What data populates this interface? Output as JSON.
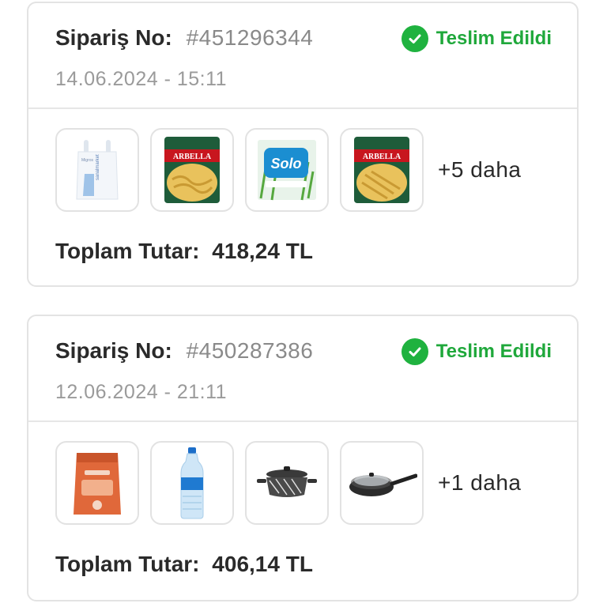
{
  "orders": [
    {
      "order_label": "Sipariş No:",
      "order_number": "#451296344",
      "date": "14.06.2024 - 15:11",
      "status": "Teslim Edildi",
      "items": [
        {
          "name": "migros-bag-icon",
          "text": "sanalmarket"
        },
        {
          "name": "arbella-pasta-icon",
          "text": "ARBELLA"
        },
        {
          "name": "solo-napkin-icon",
          "text": "Solo"
        },
        {
          "name": "arbella-pasta-icon",
          "text": "ARBELLA"
        }
      ],
      "more": "+5 daha",
      "total_label": "Toplam Tutar:",
      "total_amount": "418,24 TL"
    },
    {
      "order_label": "Sipariş No:",
      "order_number": "#450287386",
      "date": "12.06.2024 - 21:11",
      "status": "Teslim Edildi",
      "items": [
        {
          "name": "lentil-pack-icon",
          "text": ""
        },
        {
          "name": "water-bottle-icon",
          "text": ""
        },
        {
          "name": "casserole-pot-icon",
          "text": ""
        },
        {
          "name": "frying-pan-icon",
          "text": ""
        }
      ],
      "more": "+1 daha",
      "total_label": "Toplam Tutar:",
      "total_amount": "406,14 TL"
    }
  ],
  "colors": {
    "status_green": "#1fa83b",
    "border": "#e3e3e3",
    "muted": "#8a8a8a"
  }
}
